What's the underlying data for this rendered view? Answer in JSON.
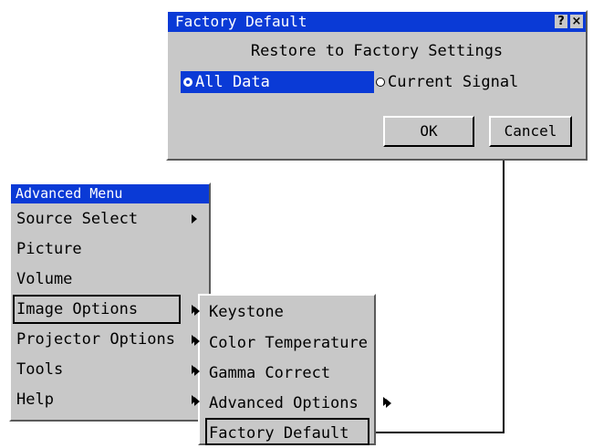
{
  "factory_dialog": {
    "title": "Factory Default",
    "help_glyph": "?",
    "close_glyph": "×",
    "heading": "Restore to Factory Settings",
    "options": [
      {
        "label": "All Data",
        "selected": true
      },
      {
        "label": "Current Signal",
        "selected": false
      }
    ],
    "ok_label": "OK",
    "cancel_label": "Cancel"
  },
  "advanced_menu": {
    "title": "Advanced Menu",
    "items": [
      {
        "label": "Source Select",
        "has_submenu": true
      },
      {
        "label": "Picture",
        "has_submenu": false
      },
      {
        "label": "Volume",
        "has_submenu": false
      },
      {
        "label": "Image Options",
        "has_submenu": true,
        "selected": true
      },
      {
        "label": "Projector Options",
        "has_submenu": true
      },
      {
        "label": "Tools",
        "has_submenu": true
      },
      {
        "label": "Help",
        "has_submenu": true
      }
    ]
  },
  "image_options_menu": {
    "items": [
      {
        "label": "Keystone",
        "has_submenu": false
      },
      {
        "label": "Color Temperature",
        "has_submenu": false
      },
      {
        "label": "Gamma Correct",
        "has_submenu": false
      },
      {
        "label": "Advanced Options",
        "has_submenu": true
      },
      {
        "label": "Factory Default",
        "has_submenu": false,
        "selected": true
      }
    ]
  },
  "colors": {
    "titlebar": "#0a3ad6",
    "panel": "#c8c8c8",
    "highlight": "#0a3ad6"
  }
}
